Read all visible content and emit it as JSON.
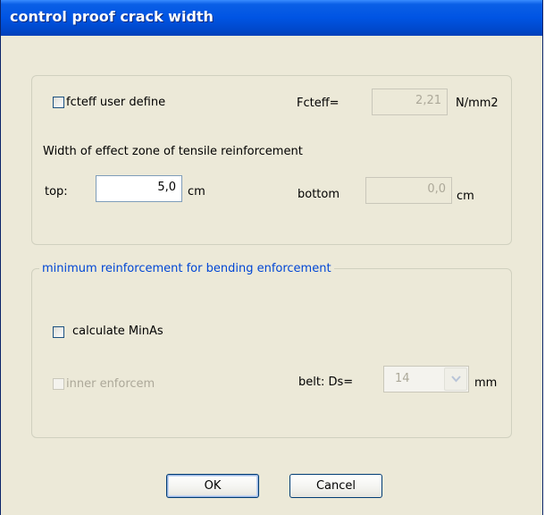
{
  "window": {
    "title": "control proof crack width"
  },
  "group1": {
    "fcteff_checkbox_label": "fcteff user define",
    "fcteff_label": "Fcteff=",
    "fcteff_value": "2,21",
    "fcteff_unit": "N/mm2",
    "width_heading": "Width of effect zone of tensile reinforcement",
    "top_label": "top:",
    "top_value": "5,0",
    "top_unit": "cm",
    "bottom_label": "bottom",
    "bottom_value": "0,0",
    "bottom_unit": "cm"
  },
  "group2": {
    "legend": "minimum  reinforcement for bending enforcement",
    "calc_label": "calculate MinAs",
    "inner_label": "inner enforcem",
    "belt_label": "belt: Ds=",
    "belt_value": "14",
    "belt_unit": "mm"
  },
  "buttons": {
    "ok": "OK",
    "cancel": "Cancel"
  }
}
